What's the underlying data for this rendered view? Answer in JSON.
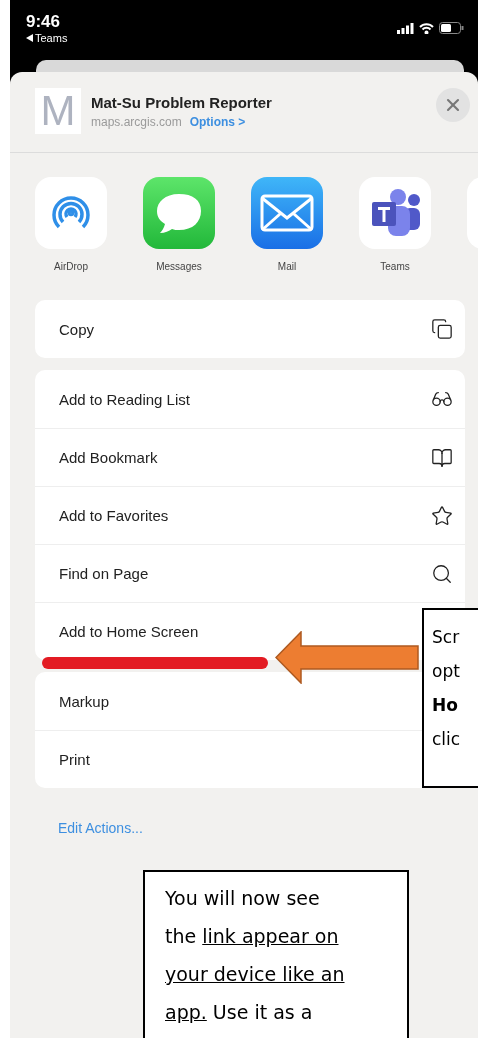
{
  "status_bar": {
    "time": "9:46",
    "back": "Teams"
  },
  "share_header": {
    "icon_letter": "M",
    "title": "Mat-Su Problem Reporter",
    "domain": "maps.arcgis.com",
    "options_link": "Options >"
  },
  "apps": [
    {
      "kind": "airdrop",
      "name": "AirDrop"
    },
    {
      "kind": "messages",
      "name": "Messages"
    },
    {
      "kind": "mail",
      "name": "Mail"
    },
    {
      "kind": "teams",
      "name": "Teams"
    },
    {
      "kind": "blank"
    }
  ],
  "action_groups": [
    {
      "actions": [
        {
          "label": "Copy"
        }
      ]
    },
    {
      "actions": [
        {
          "label": "Add to Reading List"
        },
        {
          "label": "Add Bookmark"
        },
        {
          "label": "Add to Favorites"
        },
        {
          "label": "Find on Page"
        },
        {
          "label": "Add to Home Screen"
        }
      ]
    },
    {
      "actions": [
        {
          "label": "Markup"
        },
        {
          "label": "Print"
        }
      ]
    }
  ],
  "edit_actions": "Edit Actions...",
  "side_callout": {
    "lines": [
      "Scr",
      "opt",
      "**Ho**",
      "clic"
    ]
  },
  "bottom_callout": {
    "lines": [
      [
        {
          "text": "You will now see",
          "underline": false
        }
      ],
      [
        {
          "text": "the ",
          "underline": false
        },
        {
          "text": "link appear on",
          "underline": true
        }
      ],
      [
        {
          "text": "your device like an",
          "underline": true
        }
      ],
      [
        {
          "text": "app.",
          "underline": true
        },
        {
          "text": " Use it as a",
          "underline": false
        }
      ]
    ]
  }
}
